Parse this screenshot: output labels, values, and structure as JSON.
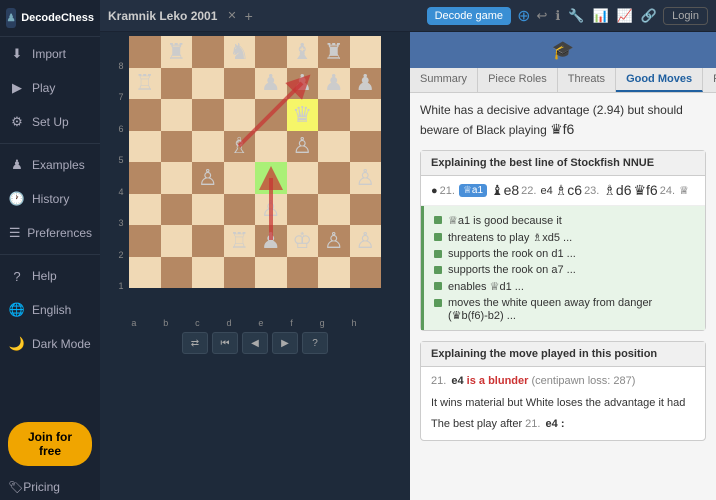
{
  "sidebar": {
    "logo": "DecodeChess",
    "items": [
      {
        "id": "import",
        "label": "Import",
        "icon": "⬇"
      },
      {
        "id": "play",
        "label": "Play",
        "icon": "▶"
      },
      {
        "id": "setup",
        "label": "Set Up",
        "icon": "⚙"
      },
      {
        "id": "examples",
        "label": "Examples",
        "icon": "♟"
      },
      {
        "id": "history",
        "label": "History",
        "icon": "🕐"
      },
      {
        "id": "preferences",
        "label": "Preferences",
        "icon": "☰"
      },
      {
        "id": "help",
        "label": "Help",
        "icon": "?"
      },
      {
        "id": "english",
        "label": "English",
        "icon": "🌐"
      },
      {
        "id": "darkmode",
        "label": "Dark Mode",
        "icon": "🌙"
      }
    ],
    "join_label": "Join for free",
    "pricing_label": "Pricing"
  },
  "topbar": {
    "game_title": "Kramnik Leko 2001",
    "decode_btn": "Decode game",
    "login_btn": "Login"
  },
  "tabs": {
    "items": [
      "Summary",
      "Piece Roles",
      "Threats",
      "Good Moves",
      "Plan"
    ]
  },
  "panel": {
    "summary_text": "White has a decisive advantage (2.94) but should beware of Black playing",
    "summary_piece": "♛f6",
    "stockfish_header": "Explaining the best line of Stockfish NNUE",
    "stockfish_moves": "● 21. ♕a1  ♝e8  22. e4  ♗c6  23. ♗d6  ♛f6  24. ♕",
    "explanation_items": [
      "♕a1  is good because it",
      "threatens to play ♗xd5 ...",
      "supports the rook on d1 ...",
      "supports the rook on a7 ...",
      "enables ♕d1 ...",
      "moves the white queen away from danger (♛b(f6)-b2) ..."
    ],
    "bottom_header": "Explaining the move played in this position",
    "bottom_move_num": "21.",
    "bottom_move": "e4",
    "bottom_blunder": "is a blunder",
    "bottom_centipawn": "(centipawn loss: 287)",
    "bottom_text1": "It wins material but White loses the advantage it had",
    "bottom_text2": "The best play after",
    "bottom_text2_num": "21.",
    "bottom_text2_move": "e4 :"
  }
}
